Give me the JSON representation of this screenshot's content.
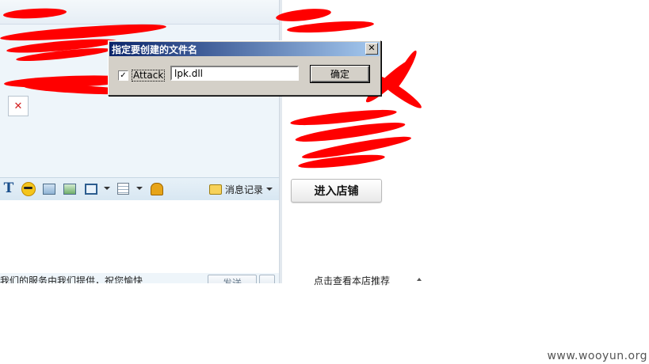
{
  "dialog": {
    "title": "指定要创建的文件名",
    "close_glyph": "✕",
    "checkbox_checked": true,
    "checkbox_glyph": "✓",
    "checkbox_label": "Attack",
    "filename_value": "lpk.dll",
    "ok_label": "确定"
  },
  "chat": {
    "broken_image_glyph": "✕",
    "toolbar": {
      "text_icon_glyph": "T",
      "history_label": "消息记录"
    },
    "bottom_tip": "我们的服务由我们提供，祝您愉快",
    "send_label": "发送"
  },
  "side_panel": {
    "shop_button_label": "进入店铺",
    "recommend_label": "点击查看本店推荐"
  },
  "watermark": "www.wooyun.org",
  "colors": {
    "redaction": "#ff0000",
    "dialog_title_start": "#0a246a",
    "dialog_title_end": "#a6caf0",
    "chat_background": "#eef5fa"
  }
}
